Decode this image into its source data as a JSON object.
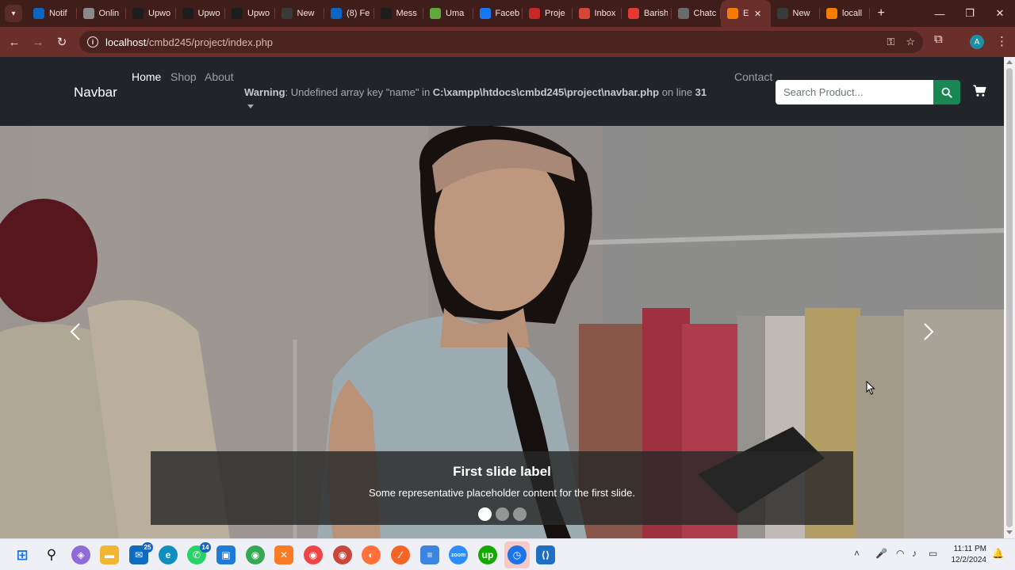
{
  "browser": {
    "tabs": [
      {
        "label": "Notif",
        "icon": "linkedin-icon",
        "color": "#0a66c2"
      },
      {
        "label": "Onlin",
        "icon": "globe-icon",
        "color": "#8a8a8a"
      },
      {
        "label": "Upwo",
        "icon": "upwork-icon",
        "color": "#1d1d1d"
      },
      {
        "label": "Upwo",
        "icon": "upwork-icon",
        "color": "#1d1d1d"
      },
      {
        "label": "Upwo",
        "icon": "upwork-icon",
        "color": "#1d1d1d"
      },
      {
        "label": "New",
        "icon": "chrome-icon",
        "color": "#3a3a3a"
      },
      {
        "label": "(8) Fe",
        "icon": "linkedin-icon",
        "color": "#0a66c2"
      },
      {
        "label": "Mess",
        "icon": "upwork-icon",
        "color": "#1d1d1d"
      },
      {
        "label": "Uma",
        "icon": "circle-icon",
        "color": "#5fa83a"
      },
      {
        "label": "Faceb",
        "icon": "facebook-icon",
        "color": "#1877f2"
      },
      {
        "label": "Proje",
        "icon": "m-icon",
        "color": "#c62828"
      },
      {
        "label": "Inbox",
        "icon": "gmail-icon",
        "color": "#d44638"
      },
      {
        "label": "Barish",
        "icon": "youtube-icon",
        "color": "#e53935"
      },
      {
        "label": "Chatc",
        "icon": "chatgpt-icon",
        "color": "#6b6b6b"
      },
      {
        "label": "E",
        "icon": "xampp-icon",
        "color": "#f57c00",
        "active": true
      },
      {
        "label": "New",
        "icon": "chrome-icon",
        "color": "#3a3a3a"
      },
      {
        "label": "locall",
        "icon": "xampp-icon",
        "color": "#f57c00"
      }
    ],
    "url_host": "localhost",
    "url_path": "/cmbd245/project/index.php",
    "profile_initial": "A"
  },
  "site": {
    "brand": "Navbar",
    "nav": {
      "home": "Home",
      "shop": "Shop",
      "about": "About",
      "contact": "Contact"
    },
    "warning": {
      "label": "Warning",
      "message": ": Undefined array key \"name\" in ",
      "file": "C:\\xampp\\htdocs\\cmbd245\\project\\navbar.php",
      "line_text": " on line ",
      "line": "31"
    },
    "search": {
      "placeholder": "Search Product..."
    },
    "accent": "#198754"
  },
  "carousel": {
    "caption_title": "First slide label",
    "caption_text": "Some representative placeholder content for the first slide.",
    "slide_count": 3,
    "active_slide": 1
  },
  "taskbar": {
    "mail_badge": "25",
    "whatsapp_badge": "14",
    "time": "11:11 PM",
    "date": "12/2/2024"
  }
}
